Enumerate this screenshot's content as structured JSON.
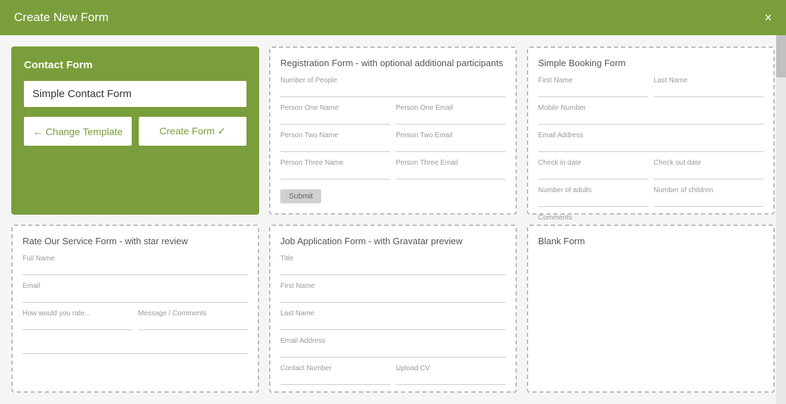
{
  "header": {
    "title": "Create New Form",
    "close_label": "×"
  },
  "contact_form": {
    "title": "Contact Form",
    "input_value": "Simple Contact Form",
    "input_placeholder": "Simple Contact Form",
    "change_template_label": "← Change Template",
    "create_form_label": "Create Form ✓"
  },
  "templates": [
    {
      "id": "registration",
      "title": "Registration Form - with optional additional participants",
      "fields": [
        {
          "label": "Number of People",
          "type": "single"
        },
        {
          "label": "Person One Name",
          "label2": "Person One Email",
          "type": "double"
        },
        {
          "label": "Person Two Name",
          "label2": "Person Two Email",
          "type": "double"
        },
        {
          "label": "Person Three Name",
          "label2": "Person Three Email",
          "type": "double"
        }
      ],
      "has_submit": true
    },
    {
      "id": "booking",
      "title": "Simple Booking Form",
      "fields": [
        {
          "label": "First Name",
          "label2": "Last Name",
          "type": "double"
        },
        {
          "label": "Mobile Number",
          "type": "single"
        },
        {
          "label": "Email Address",
          "type": "single"
        },
        {
          "label": "Check in date",
          "label2": "Check out date",
          "type": "double"
        },
        {
          "label": "Number of adults",
          "label2": "Number of children",
          "type": "double"
        },
        {
          "label": "Comments",
          "type": "single"
        }
      ],
      "has_submit": false
    },
    {
      "id": "rate-service",
      "title": "Rate Our Service Form - with star review",
      "fields": [
        {
          "label": "Full Name",
          "type": "single"
        },
        {
          "label": "Email",
          "type": "single"
        },
        {
          "label": "How would you rate...",
          "label2": "Message / Comments",
          "type": "double"
        }
      ],
      "has_submit": false
    },
    {
      "id": "job-application",
      "title": "Job Application Form - with Gravatar preview",
      "fields": [
        {
          "label": "Title",
          "type": "single"
        },
        {
          "label": "First Name",
          "type": "single"
        },
        {
          "label": "Last Name",
          "type": "single"
        },
        {
          "label": "Email Address",
          "type": "single"
        },
        {
          "label": "Contact Number",
          "label2": "Upload CV",
          "type": "double"
        }
      ],
      "has_submit": false
    },
    {
      "id": "blank",
      "title": "Blank Form",
      "fields": [],
      "has_submit": false
    }
  ]
}
